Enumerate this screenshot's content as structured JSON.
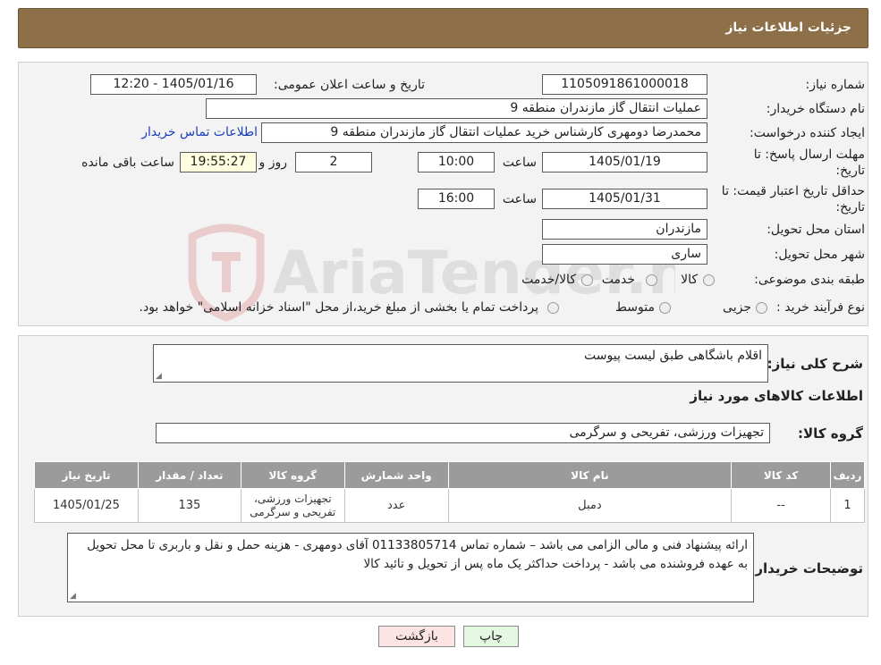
{
  "header": {
    "title": "جزئیات اطلاعات نیاز"
  },
  "need_number": {
    "label": "شماره نیاز:",
    "value": "1105091861000018"
  },
  "announce": {
    "label": "تاریخ و ساعت اعلان عمومی:",
    "value": "1405/01/16 - 12:20"
  },
  "buyer_org": {
    "label": "نام دستگاه خریدار:",
    "value": "عملیات انتقال گاز مازندران منطقه 9"
  },
  "creator": {
    "label": "ایجاد کننده درخواست:",
    "value": "محمدرضا دومهری کارشناس خرید عملیات انتقال گاز مازندران منطقه 9",
    "contact_link": "اطلاعات تماس خریدار"
  },
  "deadline": {
    "label_line1": "مهلت ارسال پاسخ: تا",
    "label_line2": "تاریخ:",
    "date": "1405/01/19",
    "time_label": "ساعت",
    "time": "10:00",
    "days": "2",
    "days_label": "روز و",
    "remaining": "19:55:27",
    "remaining_label": "ساعت باقی مانده"
  },
  "validity": {
    "label_line1": "حداقل تاریخ اعتبار قیمت: تا",
    "label_line2": "تاریخ:",
    "date": "1405/01/31",
    "time_label": "ساعت",
    "time": "16:00"
  },
  "province": {
    "label": "استان محل تحویل:",
    "value": "مازندران"
  },
  "city": {
    "label": "شهر محل تحویل:",
    "value": "ساری"
  },
  "category": {
    "label": "طبقه بندی موضوعی:",
    "options": [
      "کالا",
      "خدمت",
      "کالا/خدمت"
    ]
  },
  "process": {
    "label": "نوع فرآیند خرید :",
    "options": [
      "جزیی",
      "متوسط"
    ],
    "note": "پرداخت تمام یا بخشی از مبلغ خرید،از محل \"اسناد خزانه اسلامی\" خواهد بود."
  },
  "description": {
    "label": "شرح کلی نیاز:",
    "value": "اقلام باشگاهی طبق لیست پیوست"
  },
  "goods_info": {
    "title": "اطلاعات کالاهای مورد نیاز"
  },
  "goods_group": {
    "label": "گروه کالا:",
    "value": "تجهیزات ورزشی، تفریحی و سرگرمی"
  },
  "table": {
    "headers": [
      "ردیف",
      "کد کالا",
      "نام کالا",
      "واحد شمارش",
      "گروه کالا",
      "تعداد / مقدار",
      "تاریخ نیاز"
    ],
    "rows": [
      [
        "1",
        "--",
        "دمبل",
        "عدد",
        "تجهیزات ورزشی، تفریحی و سرگرمی",
        "135",
        "1405/01/25"
      ]
    ]
  },
  "buyer_notes": {
    "label": "توضیحات خریدار:",
    "value": "ارائه پیشنهاد فنی  و مالی الزامی می باشد – شماره تماس 01133805714 آقای دومهری  - هزینه حمل و نقل و باربری تا محل تحویل به عهده فروشنده می باشد - پرداخت حداکثر یک ماه پس از تحویل و تائید کالا"
  },
  "buttons": {
    "print": "چاپ",
    "back": "بازگشت"
  },
  "watermark": {
    "text": "AriaTender.neT"
  },
  "colors": {
    "header_bg": "#8d7047",
    "table_header_bg": "#9b9b9b",
    "remaining_bg": "#ffffe0",
    "back_button_bg": "#fce4e4",
    "print_button_bg": "#e4f7e0",
    "link": "#1a3eb8"
  }
}
